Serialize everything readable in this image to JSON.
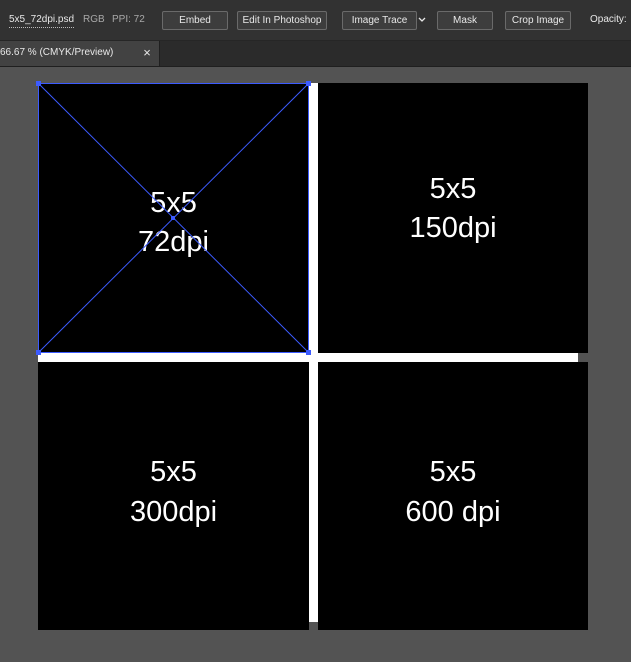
{
  "control_bar": {
    "file_name": "5x5_72dpi.psd",
    "color_mode": "RGB",
    "ppi": "PPI: 72",
    "buttons": {
      "embed": "Embed",
      "edit_in_photoshop": "Edit In Photoshop",
      "image_trace": "Image Trace",
      "mask": "Mask",
      "crop_image": "Crop Image"
    },
    "opacity_label": "Opacity:"
  },
  "tab": {
    "title": "66.67 % (CMYK/Preview)",
    "close_glyph": "×"
  },
  "artboards": {
    "top_left": {
      "line1": "5x5",
      "line2": "72dpi"
    },
    "top_right": {
      "line1": "5x5",
      "line2": "150dpi"
    },
    "bottom_left": {
      "line1": "5x5",
      "line2": "300dpi"
    },
    "bottom_right": {
      "line1": "5x5",
      "line2": "600 dpi"
    }
  },
  "colors": {
    "ui_background": "#535353",
    "control_bar": "#323232",
    "tab_bar": "#2b2b2b",
    "artboard_fill": "#000000",
    "divider": "#ffffff",
    "selection": "#3c5bff"
  },
  "icons": {
    "dropdown": "chevron-down-icon",
    "close": "close-icon"
  }
}
